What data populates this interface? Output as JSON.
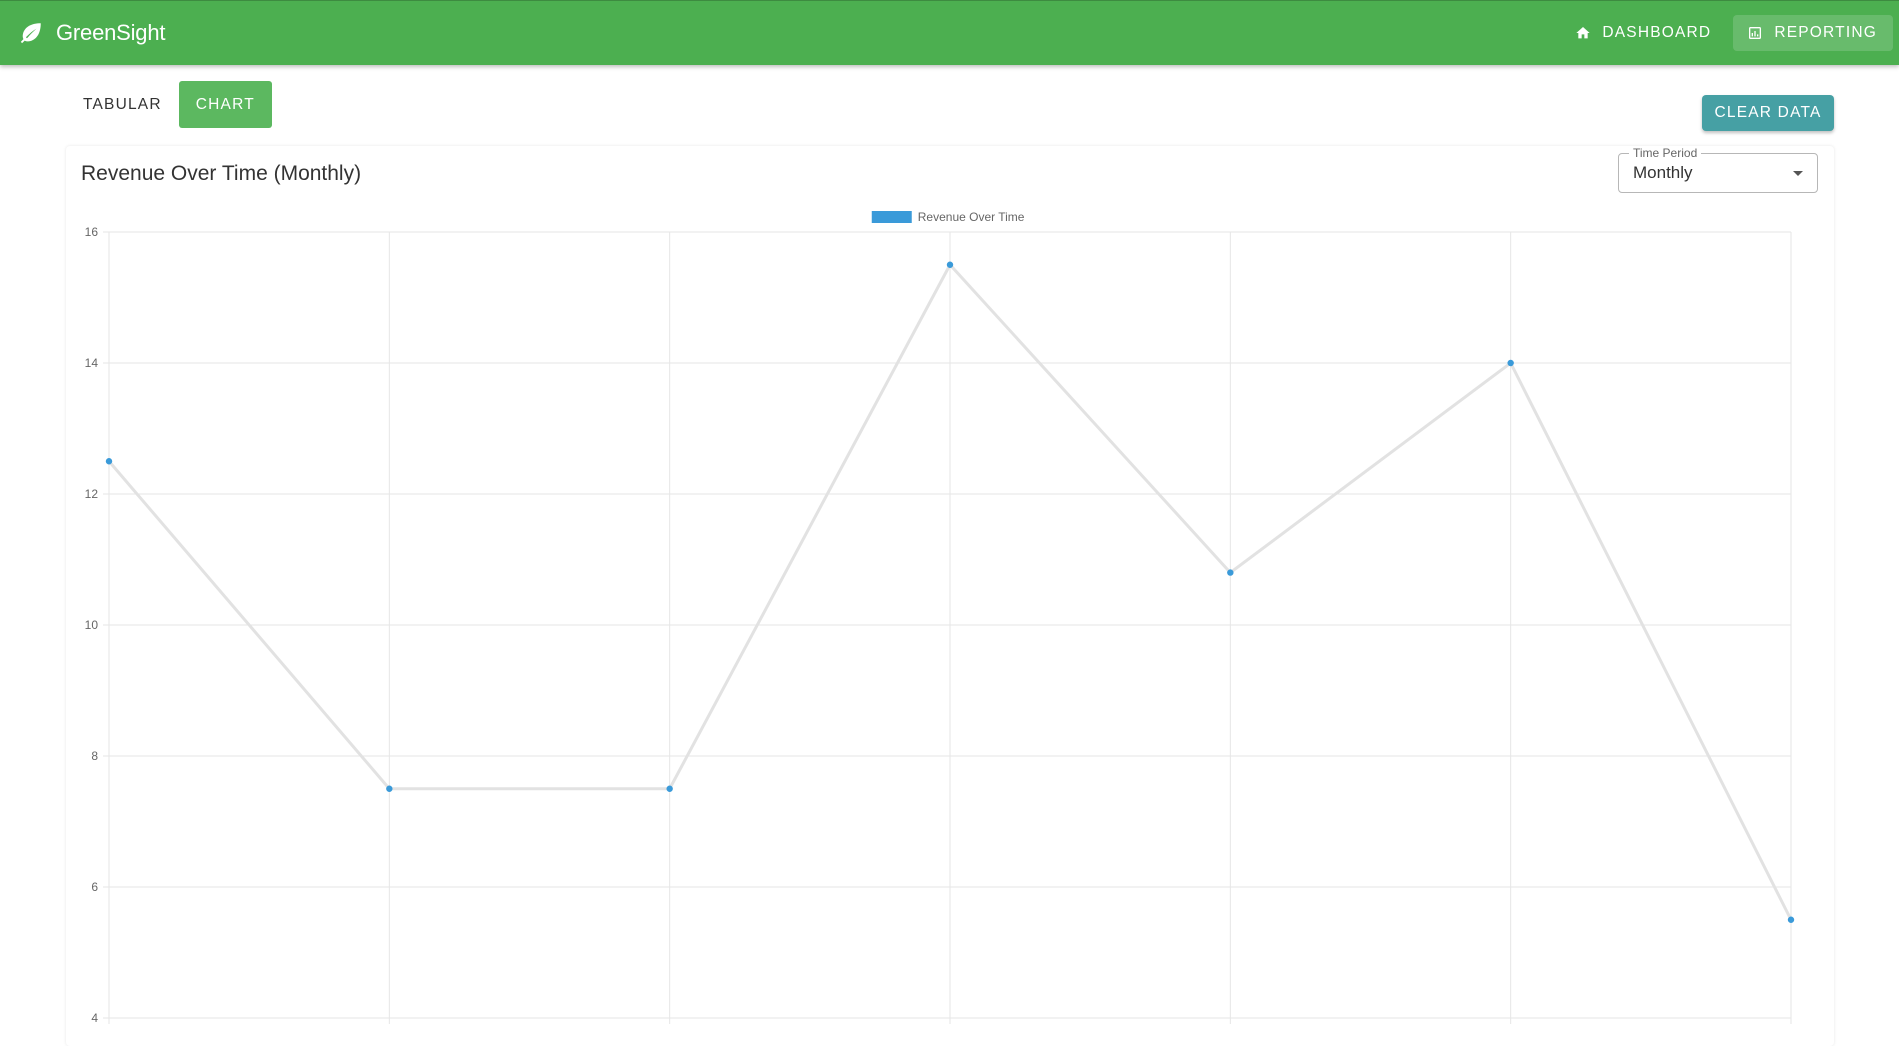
{
  "app": {
    "name": "GreenSight",
    "nav": [
      {
        "label": "DASHBOARD",
        "icon": "home-icon",
        "active": false
      },
      {
        "label": "REPORTING",
        "icon": "report-icon",
        "active": true
      }
    ]
  },
  "view_toggle": {
    "options": [
      "TABULAR",
      "CHART"
    ],
    "selected": "CHART"
  },
  "actions": {
    "clear_label": "CLEAR DATA"
  },
  "card": {
    "title": "Revenue Over Time (Monthly)",
    "time_period": {
      "label": "Time Period",
      "value": "Monthly"
    }
  },
  "colors": {
    "appbar": "#4caf50",
    "toggle_selected": "#5cb860",
    "clear_button": "#46a0a4",
    "point": "#3a9ad9",
    "legend_box": "#3a9ad9",
    "line": "#e2e2e2",
    "grid": "#e6e6e6"
  },
  "chart_data": {
    "type": "line",
    "legend": [
      "Revenue Over Time"
    ],
    "legend_position": "top-center",
    "grid": true,
    "ylim": [
      4,
      16
    ],
    "yticks": [
      16,
      14,
      12,
      10,
      8,
      6,
      4
    ],
    "series": [
      {
        "name": "Revenue Over Time",
        "values": [
          12.5,
          7.5,
          7.5,
          15.5,
          10.8,
          14,
          5.5
        ]
      }
    ]
  }
}
